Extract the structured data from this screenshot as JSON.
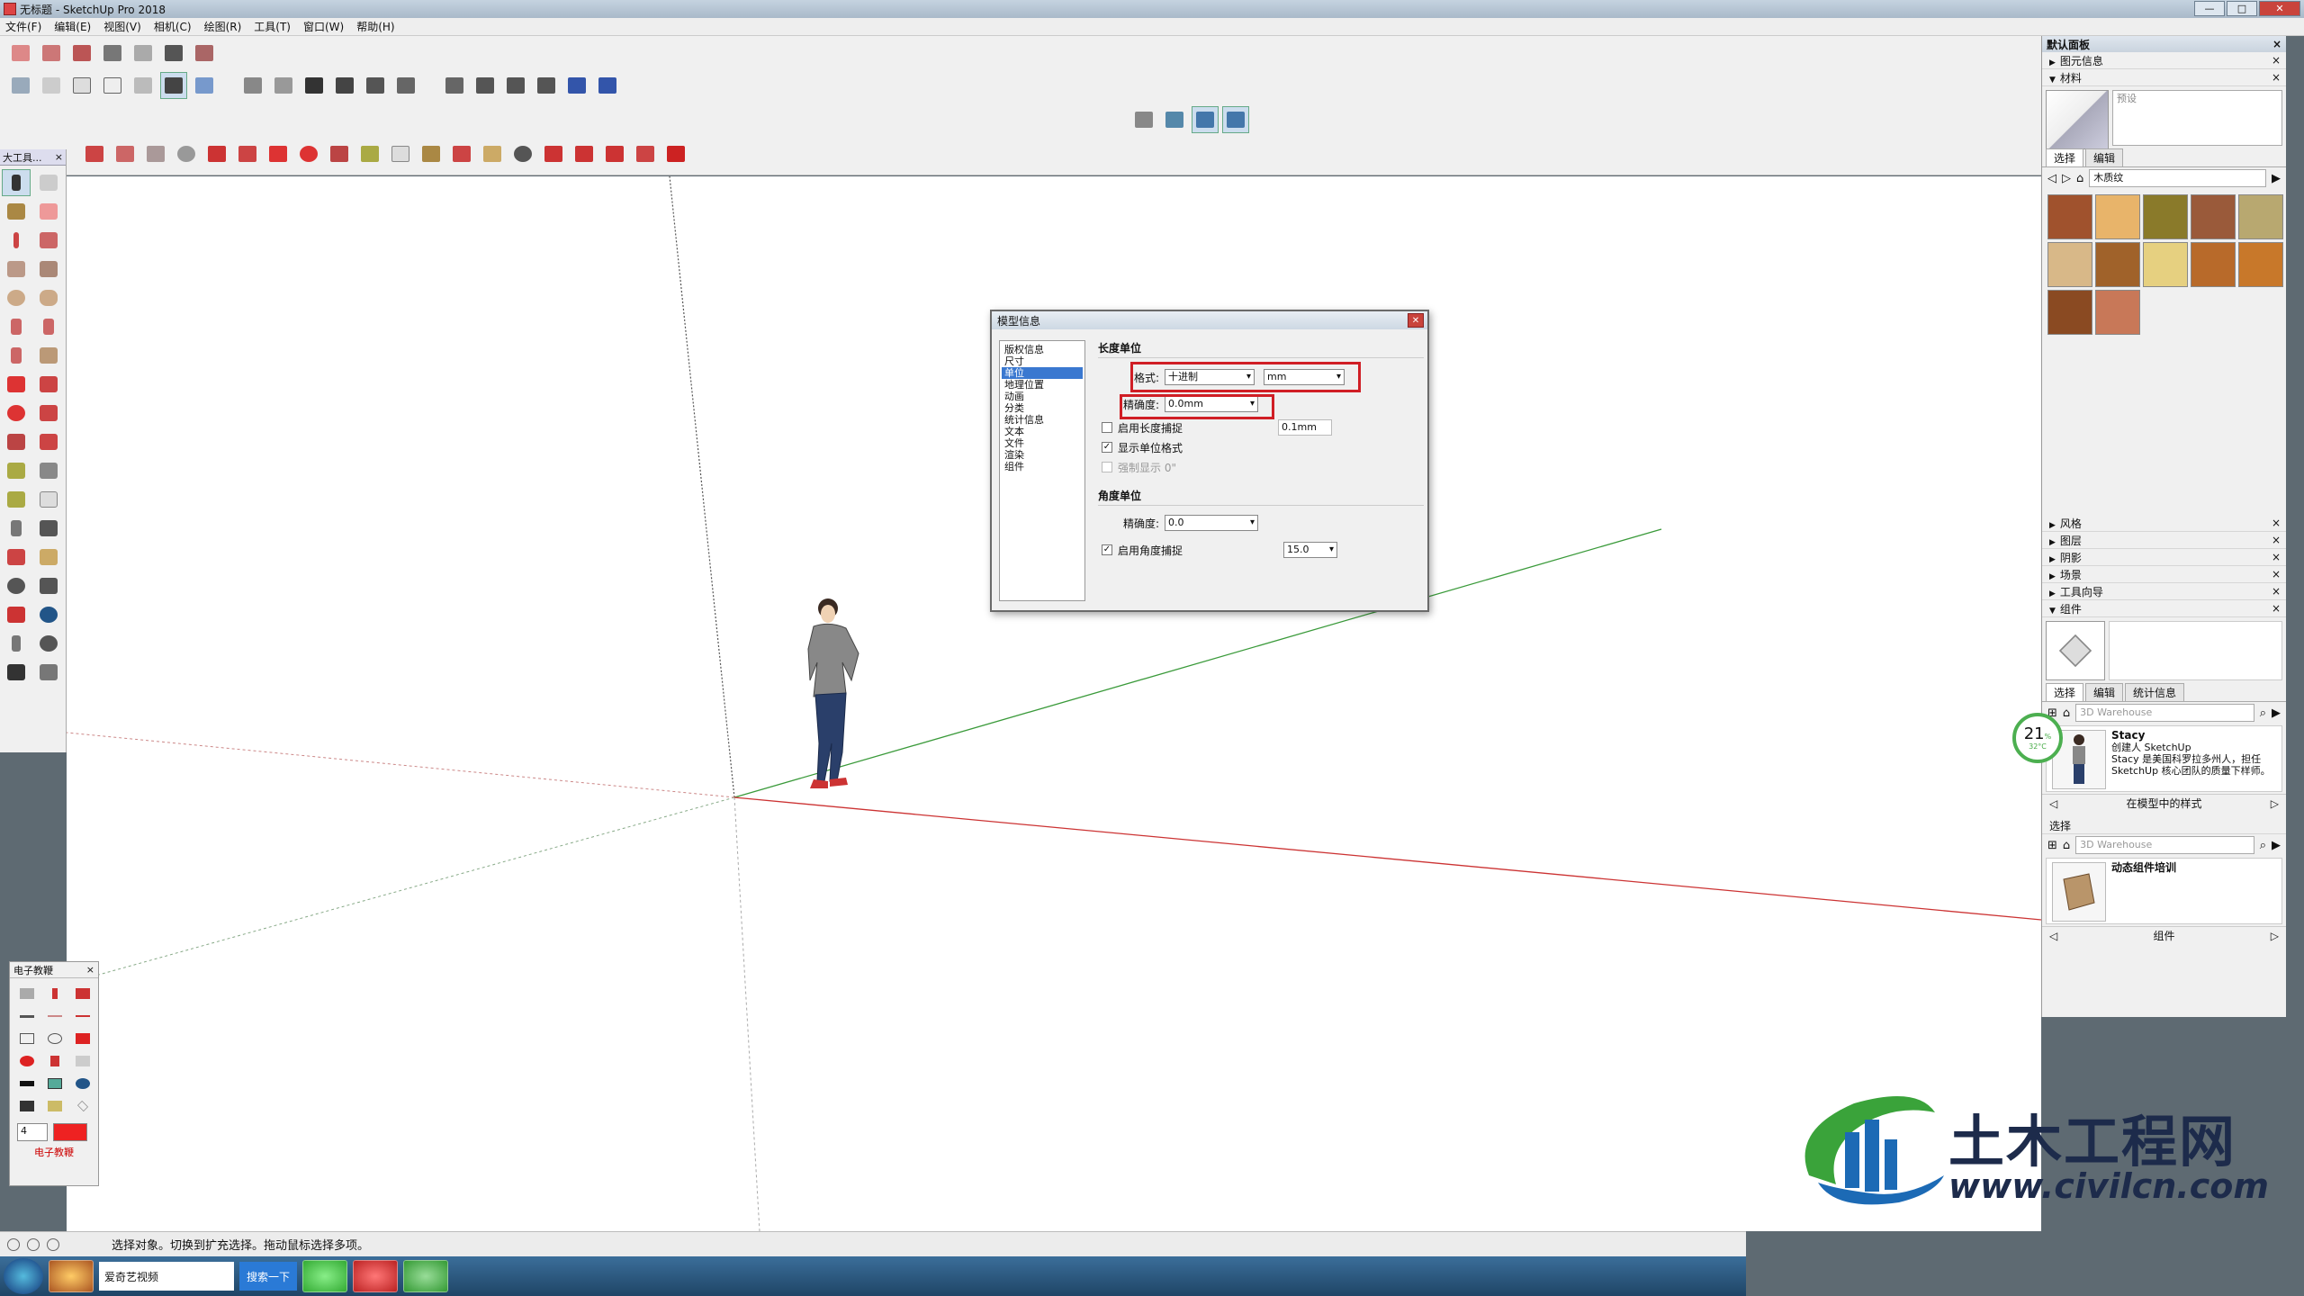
{
  "window": {
    "title": "无标题 - SketchUp Pro 2018",
    "controls": [
      "—",
      "□",
      "✕"
    ]
  },
  "menu": [
    "文件(F)",
    "编辑(E)",
    "视图(V)",
    "相机(C)",
    "绘图(R)",
    "工具(T)",
    "窗口(W)",
    "帮助(H)"
  ],
  "left_toolbar": {
    "title": "大工具..."
  },
  "ebook": {
    "title": "电子教鞭",
    "label": "电子教鞭",
    "size_value": "4"
  },
  "status": {
    "text": "选择对象。切换到扩充选择。拖动鼠标选择多项。"
  },
  "taskbar": {
    "app1": "爱奇艺视频",
    "search_button": "搜索一下"
  },
  "dialog": {
    "title": "模型信息",
    "nav": [
      "版权信息",
      "尺寸",
      "单位",
      "地理位置",
      "动画",
      "分类",
      "统计信息",
      "文本",
      "文件",
      "渲染",
      "组件"
    ],
    "nav_selected": 2,
    "length_section": "长度单位",
    "format_label": "格式:",
    "format_value": "十进制",
    "unit_value": "mm",
    "precision_label": "精确度:",
    "precision_value": "0.0mm",
    "length_snap_label": "启用长度捕捉",
    "length_snap_value": "0.1mm",
    "show_unit_label": "显示单位格式",
    "force_label": "强制显示 0\"",
    "angle_section": "角度单位",
    "angle_precision_label": "精确度:",
    "angle_precision_value": "0.0",
    "angle_snap_label": "启用角度捕捉",
    "angle_snap_value": "15.0"
  },
  "right_panel": {
    "title": "默认面板",
    "entity_info": "图元信息",
    "materials": "材料",
    "material_name_placeholder": "预设",
    "tab_select": "选择",
    "tab_edit": "编辑",
    "material_library": "木质纹",
    "swatch_colors": [
      "#a0522d",
      "#e8b46a",
      "#8a7a2a",
      "#9a5a3a",
      "#b8a870",
      "#d8b888",
      "#a0622a",
      "#e6d080",
      "#b86a2a",
      "#c8782a",
      "#8a4a22",
      "#c87858"
    ],
    "collapsed": [
      "风格",
      "图层",
      "阴影",
      "场景",
      "工具向导"
    ],
    "components": "组件",
    "comp_tabs": [
      "选择",
      "编辑",
      "统计信息"
    ],
    "search_placeholder": "3D Warehouse",
    "comp_name": "Stacy",
    "comp_line1": "创建人 SketchUp",
    "comp_line2": "Stacy 是美国科罗拉多州人，担任 SketchUp 核心团队的质量下样师。",
    "comp_footer": "在模型中的样式",
    "select_label": "选择",
    "search_placeholder2": "3D Warehouse",
    "comp2_name": "动态组件培训",
    "comp2_footer": "组件"
  },
  "gauge": {
    "percent": "21",
    "unit": "%",
    "temp": "32°C"
  },
  "logo": {
    "cn": "土木工程网",
    "url": "www.civilcn.com"
  }
}
